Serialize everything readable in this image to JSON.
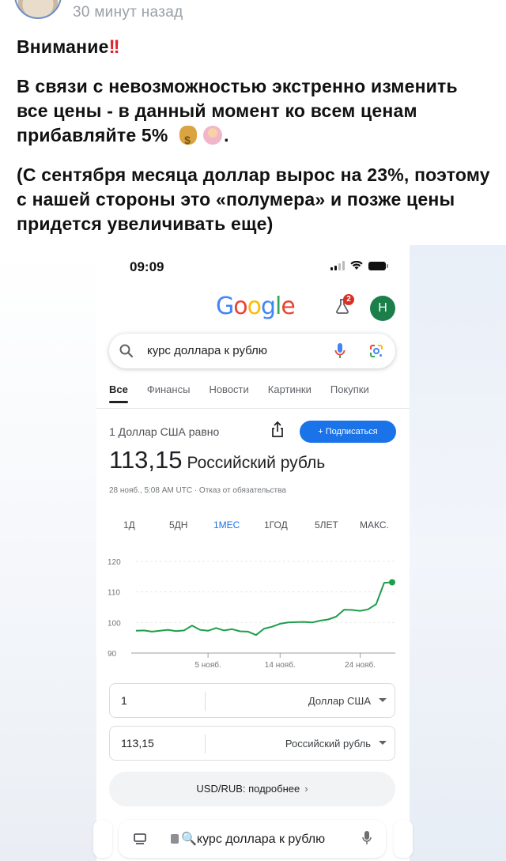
{
  "post": {
    "time_ago": "30 минут назад",
    "title": "Внимание",
    "title_emoji": "‼️",
    "body": "В связи с невозможностью экстренно изменить все цены - в данный момент ко всем ценам прибавляйте 5%",
    "body_end": ".",
    "note": "(С сентября месяца доллар вырос на 23%, поэтому с нашей стороны это «полумера» и позже цены придется увеличивать еще)"
  },
  "phone": {
    "status_time": "09:09",
    "logo": "Google",
    "notification_count": "2",
    "avatar_letter": "H",
    "search_query": "курс доллара к рублю",
    "tabs": [
      "Все",
      "Финансы",
      "Новости",
      "Картинки",
      "Покупки"
    ],
    "equals_label": "1 Доллар США равно",
    "subscribe_label": "+ Подписаться",
    "rate_value": "113,15",
    "rate_unit": "Российский рубль",
    "rate_meta": "28 нояб., 5:08 AM UTC · Отказ от обязательства",
    "ranges": [
      "1Д",
      "5ДН",
      "1МЕС",
      "1ГОД",
      "5ЛЕТ",
      "МАКС."
    ],
    "active_range": "1МЕС",
    "converter": {
      "from_value": "1",
      "from_currency": "Доллар США",
      "to_value": "113,15",
      "to_currency": "Российский рубль"
    },
    "more_label": "USD/RUB: подробнее",
    "address_text": "курс доллара к рублю",
    "accent_color": "#1a73e8",
    "chart_color": "#1e9e4a"
  },
  "chart_data": {
    "type": "line",
    "ylim": [
      90,
      120
    ],
    "yticks": [
      90,
      100,
      110,
      120
    ],
    "xtick_labels": [
      "5 нояб.",
      "14 нояб.",
      "24 нояб."
    ],
    "xtick_days": [
      5,
      14,
      24
    ],
    "x": [
      27,
      28,
      29,
      30,
      31,
      1,
      2,
      3,
      4,
      5,
      6,
      7,
      8,
      9,
      10,
      11,
      12,
      13,
      14,
      15,
      16,
      17,
      18,
      19,
      20,
      21,
      22,
      23,
      24,
      25,
      26,
      27,
      28
    ],
    "series": [
      {
        "values": [
          97.3,
          97.4,
          97.0,
          97.3,
          97.6,
          97.2,
          97.4,
          99.0,
          97.6,
          97.3,
          98.2,
          97.4,
          97.8,
          97.1,
          97.0,
          95.9,
          98.0,
          98.6,
          99.6,
          100.0,
          100.1,
          100.2,
          100.0,
          100.6,
          101.0,
          101.9,
          104.2,
          104.1,
          103.8,
          104.3,
          106.0,
          113.0,
          113.15
        ]
      }
    ]
  }
}
